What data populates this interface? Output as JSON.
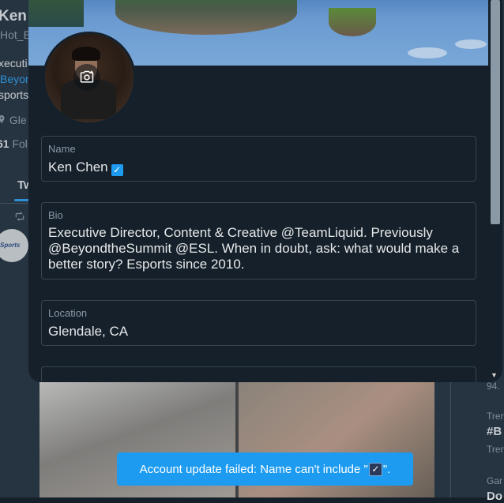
{
  "background": {
    "profile_name": "Ken C",
    "handle": "Hot_E",
    "bio_line1": "xecuti",
    "bio_line2": "Beyon",
    "bio_line3": "sports",
    "location": "Gle",
    "followers_count": "61",
    "followers_label": "Fol",
    "tab_label": "Tw",
    "avatar_text": "Sports",
    "right_column": [
      "94.",
      "Tren",
      "#B",
      "Tren",
      "Gar",
      "Do"
    ]
  },
  "modal": {
    "name_field": {
      "label": "Name",
      "value": "Ken Chen",
      "checkmark": "✓"
    },
    "bio_field": {
      "label": "Bio",
      "value": "Executive Director, Content & Creative @TeamLiquid. Previously @BeyondtheSummit @ESL. When in doubt, ask: what would make a better story? Esports since 2010."
    },
    "location_field": {
      "label": "Location",
      "value": "Glendale, CA"
    }
  },
  "toast": {
    "prefix": "Account update failed: Name can't include \"",
    "checkmark": "✓",
    "suffix": "\"."
  },
  "colors": {
    "background": "#15202b",
    "accent": "#1d9bf0",
    "border": "#38444d",
    "muted_text": "#8b98a5",
    "text": "#e7e9ea"
  }
}
